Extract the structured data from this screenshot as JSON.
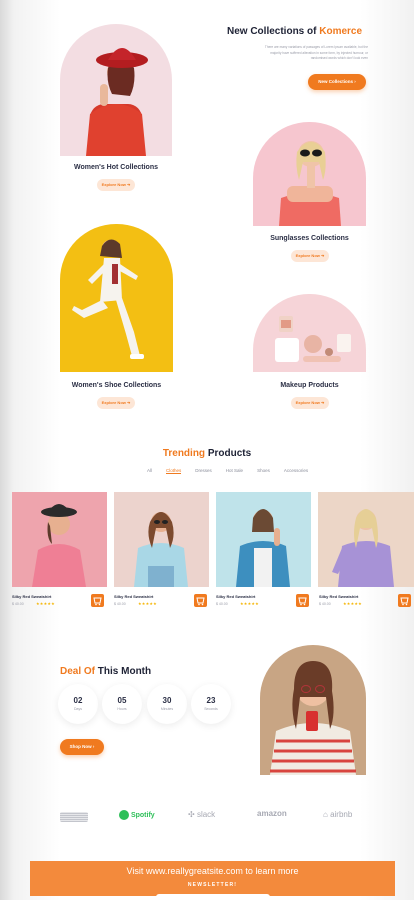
{
  "hero": {
    "title_prefix": "New Collections of ",
    "title_accent": "Komerce",
    "description_line1": "There are many variations of passages of Lorem Ipsum available, but the",
    "description_line2": "majority have suffered alteration in some form, by injected humour, or",
    "description_line3": "randomised words which don't look even",
    "cta_label": "New Collections",
    "cta_icon": "chevron-right-icon"
  },
  "collections": [
    {
      "caption": "Women's Hot Collections",
      "button": "Explore Now"
    },
    {
      "caption": "Sunglasses Collections",
      "button": "Explore Now"
    },
    {
      "caption": "Women's Shoe Collections",
      "button": "Explore Now"
    },
    {
      "caption": "Makeup Products",
      "button": "Explore Now"
    }
  ],
  "trending": {
    "title_accent": "Trending",
    "title_rest": " Products",
    "tabs": [
      "All",
      "Clothes",
      "Dresses",
      "Hot Sale",
      "Shoes",
      "Accessories"
    ],
    "active_tab": "Clothes",
    "products": [
      {
        "name": "Silky Red Sweatshirt",
        "price": "$ 40.00",
        "rating": "★★★★★"
      },
      {
        "name": "Silky Red Sweatshirt",
        "price": "$ 40.00",
        "rating": "★★★★★"
      },
      {
        "name": "Silky Red Sweatshirt",
        "price": "$ 40.00",
        "rating": "★★★★★"
      },
      {
        "name": "Silky Red Sweatshirt",
        "price": "$ 40.00",
        "rating": "★★★★★"
      }
    ]
  },
  "deal": {
    "title_accent": "Deal Of",
    "title_rest": " This Month",
    "countdown": [
      {
        "value": "02",
        "label": "Days"
      },
      {
        "value": "05",
        "label": "Hours"
      },
      {
        "value": "30",
        "label": "Minutes"
      },
      {
        "value": "23",
        "label": "Seconds"
      }
    ],
    "cta_label": "Shop Now"
  },
  "brands": [
    "amazon-prime",
    "Spotify",
    "slack",
    "amazon",
    "airbnb"
  ],
  "footer": {
    "visit_text": "Visit www.reallygreatsite.com to learn more",
    "newsletter_label": "NEWSLETTER!"
  },
  "colors": {
    "accent": "#f07a1f",
    "dark": "#1e2235"
  }
}
